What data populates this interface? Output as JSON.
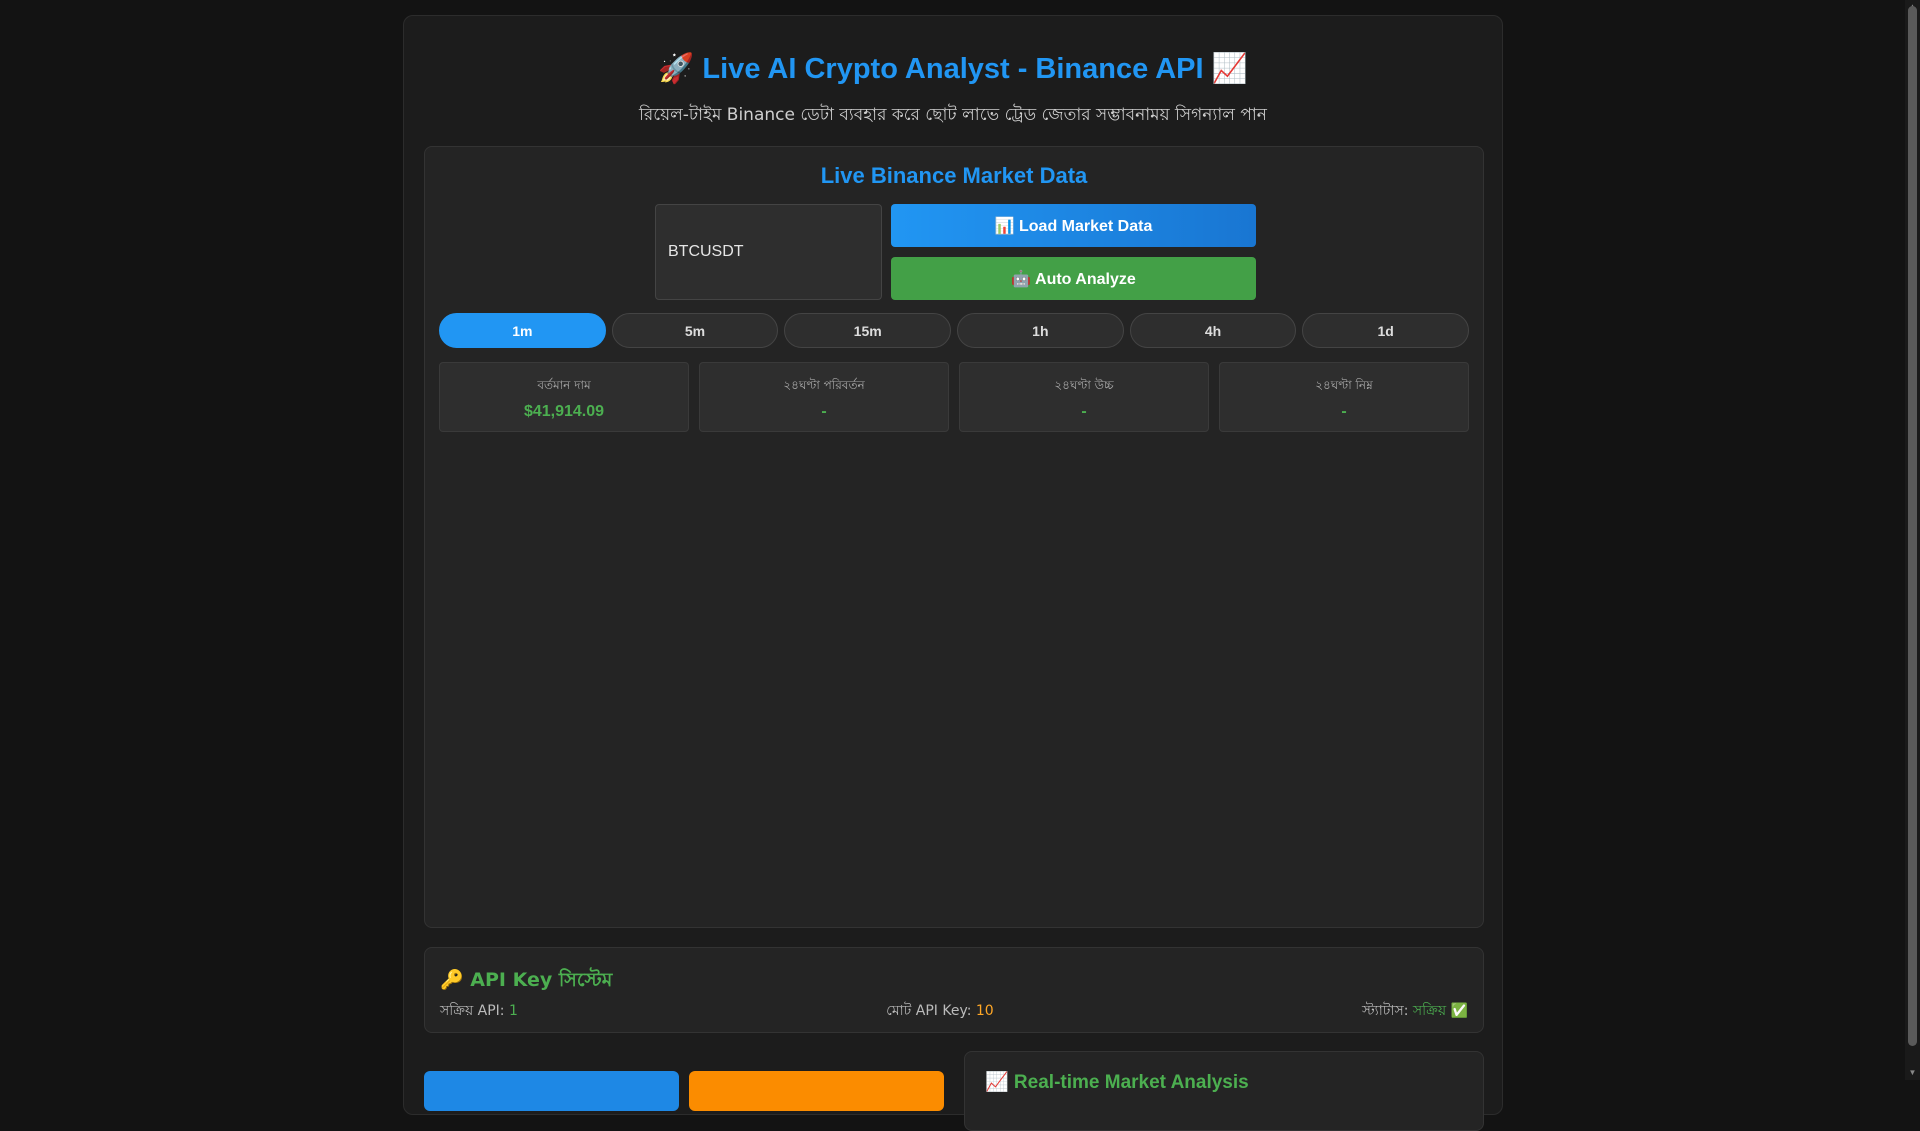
{
  "header": {
    "title": "🚀 Live AI Crypto Analyst - Binance API 📈",
    "subtitle": "রিয়েল-টাইম Binance ডেটা ব্যবহার করে ছোট লাভে ট্রেড জেতার সম্ভাবনাময় সিগন্যাল পান"
  },
  "market": {
    "title": "Live Binance Market Data",
    "symbol_value": "BTCUSDT",
    "load_button": "📊 Load Market Data",
    "auto_button": "🤖 Auto Analyze",
    "timeframes": [
      "1m",
      "5m",
      "15m",
      "1h",
      "4h",
      "1d"
    ],
    "active_timeframe": "1m",
    "stats": [
      {
        "label": "বর্তমান দাম",
        "value": "$41,914.09"
      },
      {
        "label": "২৪ঘণ্টা পরিবর্তন",
        "value": "-"
      },
      {
        "label": "২৪ঘণ্টা উচ্চ",
        "value": "-"
      },
      {
        "label": "২৪ঘণ্টা নিম্ন",
        "value": "-"
      }
    ]
  },
  "api_system": {
    "title": "🔑 API Key সিস্টেম",
    "active_label": "সক্রিয় API:",
    "active_value": "1",
    "total_label": "মোট API Key:",
    "total_value": "10",
    "status_label": "স্ট্যাটাস:",
    "status_value": "সক্রিয় ✅"
  },
  "analysis": {
    "title": "📈 Real-time Market Analysis"
  },
  "colors": {
    "accent_blue": "#2196f3",
    "accent_green": "#4caf50",
    "accent_orange": "#ffa726"
  }
}
